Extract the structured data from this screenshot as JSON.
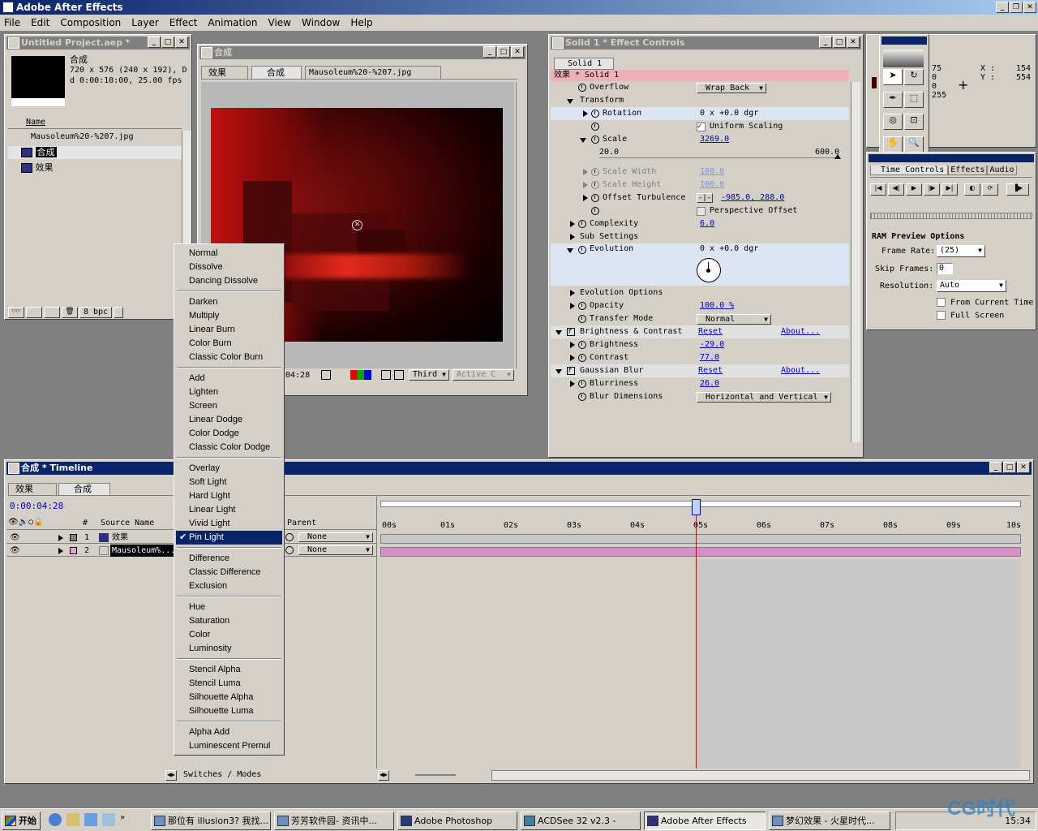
{
  "app": {
    "title": "Adobe After Effects",
    "menus": [
      "File",
      "Edit",
      "Composition",
      "Layer",
      "Effect",
      "Animation",
      "View",
      "Window",
      "Help"
    ]
  },
  "project": {
    "title": "Untitled Project.aep *",
    "comp_name": "合成",
    "comp_info_1": "720 x 576  (240 x 192), D",
    "comp_info_2": "d 0:00:10:00, 25.00 fps",
    "col_name": "Name",
    "items": [
      "Mausoleum%20-%207.jpg",
      "合成",
      "效果"
    ],
    "bpc": "8 bpc"
  },
  "comp": {
    "title": "合成",
    "tabs": [
      "效果",
      "合成",
      "Mausoleum%20-%207.jpg"
    ],
    "time": "04:28",
    "resolution": "Third",
    "camera": "Active C"
  },
  "effects": {
    "title": "Solid 1 * Effect Controls",
    "tab": "Solid 1",
    "header": "效果 * Solid 1",
    "overflow_label": "Overflow",
    "overflow_value": "Wrap Back",
    "transform_label": "Transform",
    "rotation_label": "Rotation",
    "rotation_value": "0 x +0.0 dgr",
    "uniform_label": "Uniform Scaling",
    "scale_label": "Scale",
    "scale_value": "3269.0",
    "scale_min": "20.0",
    "scale_max": "600.0",
    "scale_width_label": "Scale Width",
    "scale_width_value": "100.0",
    "scale_height_label": "Scale Height",
    "scale_height_value": "100.0",
    "offset_label": "Offset Turbulence",
    "offset_value": "-985.0, 288.0",
    "perspective_label": "Perspective Offset",
    "complexity_label": "Complexity",
    "complexity_value": "6.0",
    "subsettings_label": "Sub Settings",
    "evolution_label": "Evolution",
    "evolution_value": "0 x +0.0 dgr",
    "evo_options_label": "Evolution Options",
    "opacity_label": "Opacity",
    "opacity_value": "100.0 %",
    "transfer_label": "Transfer Mode",
    "transfer_value": "Normal",
    "bc_label": "Brightness & Contrast",
    "reset": "Reset",
    "about": "About...",
    "brightness_label": "Brightness",
    "brightness_value": "-29.0",
    "contrast_label": "Contrast",
    "contrast_value": "77.0",
    "gb_label": "Gaussian Blur",
    "blurriness_label": "Blurriness",
    "blurriness_value": "26.0",
    "blurdim_label": "Blur Dimensions",
    "blurdim_value": "Horizontal and Vertical"
  },
  "info": {
    "r": "75",
    "g": "0",
    "b": "0",
    "a": "255",
    "x_label": "X :",
    "y_label": "Y :",
    "x": "154",
    "y": "554"
  },
  "time_controls": {
    "tabs": [
      "Time Controls",
      "Effects",
      "Audio"
    ],
    "ram_title": "RAM Preview Options",
    "frame_rate_label": "Frame Rate:",
    "frame_rate": "(25)",
    "skip_label": "Skip Frames:",
    "skip": "0",
    "resolution_label": "Resolution:",
    "resolution": "Auto",
    "from_current": "From Current Time",
    "full_screen": "Full Screen"
  },
  "timeline": {
    "title": "合成 * Timeline",
    "tabs": [
      "效果",
      "合成"
    ],
    "time": "0:00:04:28",
    "col_num": "#",
    "col_source": "Source Name",
    "col_parent": "Parent",
    "layers": [
      {
        "num": "1",
        "name": "效果",
        "parent": "None"
      },
      {
        "num": "2",
        "name": "Mausoleum%...",
        "parent": "None"
      }
    ],
    "ruler": [
      "00s",
      "01s",
      "02s",
      "03s",
      "04s",
      "05s",
      "06s",
      "07s",
      "08s",
      "09s",
      "10s"
    ],
    "switches": "Switches / Modes"
  },
  "blend_menu": {
    "groups": [
      [
        "Normal",
        "Dissolve",
        "Dancing Dissolve"
      ],
      [
        "Darken",
        "Multiply",
        "Linear Burn",
        "Color Burn",
        "Classic Color Burn"
      ],
      [
        "Add",
        "Lighten",
        "Screen",
        "Linear Dodge",
        "Color Dodge",
        "Classic Color Dodge"
      ],
      [
        "Overlay",
        "Soft Light",
        "Hard Light",
        "Linear Light",
        "Vivid Light",
        "Pin Light"
      ],
      [
        "Difference",
        "Classic Difference",
        "Exclusion"
      ],
      [
        "Hue",
        "Saturation",
        "Color",
        "Luminosity"
      ],
      [
        "Stencil Alpha",
        "Stencil Luma",
        "Silhouette Alpha",
        "Silhouette Luma"
      ],
      [
        "Alpha Add",
        "Luminescent Premul"
      ]
    ],
    "selected": "Pin Light"
  },
  "taskbar": {
    "start": "开始",
    "tasks": [
      "那位有 illusion3? 我找...",
      "芳芳软件园- 资讯中...",
      "Adobe Photoshop",
      "ACDSee 32 v2.3 -",
      "Adobe After Effects",
      "梦幻效果 - 火星时代..."
    ],
    "clock": "15:34"
  },
  "watermark": "CG时代",
  "colors": {
    "title_active": "#0a246a",
    "face": "#d4d0c8",
    "selection": "#0a246a",
    "link": "#0000c0",
    "layer_bar": "#d98fc8"
  }
}
